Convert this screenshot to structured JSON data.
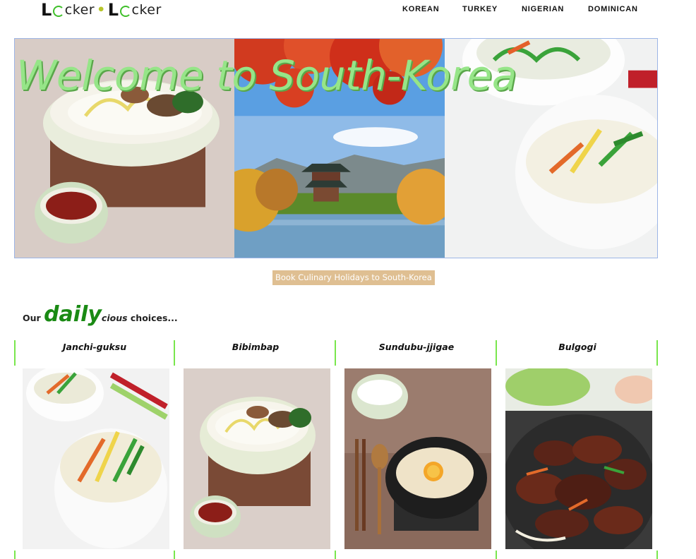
{
  "header": {
    "logo_text": "Locker·Locker",
    "nav": [
      {
        "label": "KOREAN"
      },
      {
        "label": "TURKEY"
      },
      {
        "label": "NIGERIAN"
      },
      {
        "label": "DOMINICAN"
      }
    ]
  },
  "hero": {
    "title": "Welcome to South-Korea"
  },
  "cta": {
    "label": "Book Culinary Holidays to South-Korea"
  },
  "choices": {
    "prefix": "Our",
    "highlight": "daily",
    "suffix_italic": "cious",
    "suffix": "choices..."
  },
  "dishes": [
    {
      "name": "Janchi-guksu"
    },
    {
      "name": "Bibimbap"
    },
    {
      "name": "Sundubu-jjigae"
    },
    {
      "name": "Bulgogi"
    }
  ],
  "colors": {
    "accent_green": "#1a8a14",
    "title_green": "#96e588",
    "cta_bg": "#dfbf92",
    "divider": "#79e64d"
  }
}
